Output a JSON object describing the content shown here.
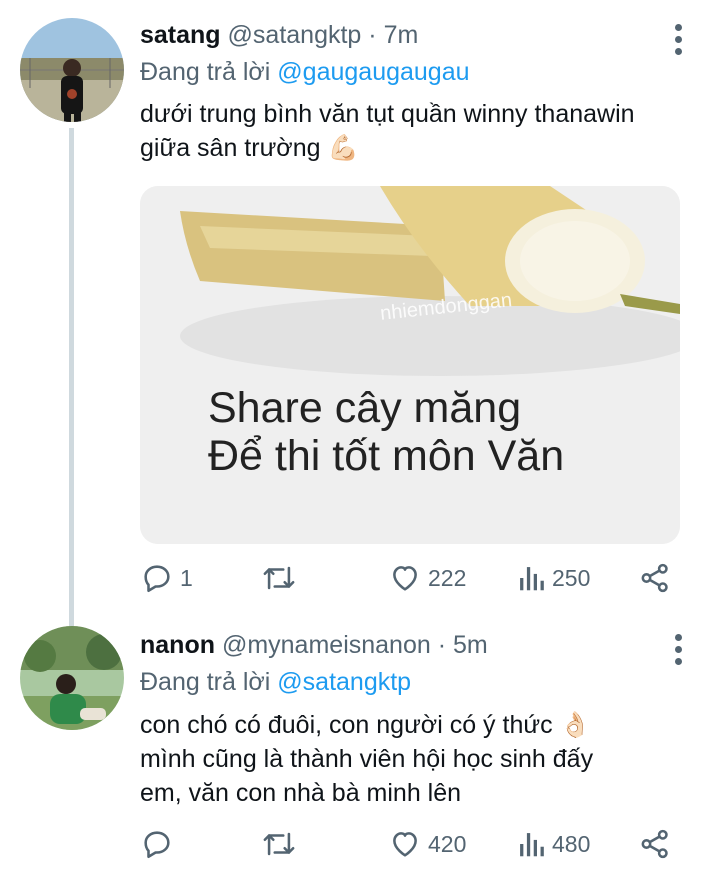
{
  "tweets": [
    {
      "name": "satang",
      "handle": "@satangktp",
      "time": "· 7m",
      "reply_prefix": "Đang trả lời",
      "reply_to": "@gaugaugaugau",
      "text_lines": [
        "dưới trung bình văn tụt quần winny thanawin",
        "giữa sân trường 💪🏻"
      ],
      "media": {
        "caption_lines": [
          "Share cây măng",
          "Để thi tốt môn Văn"
        ],
        "watermark": "nhiemdonggan"
      },
      "actions": {
        "reply_count": "1",
        "retweet_count": "",
        "like_count": "222",
        "view_count": "250"
      }
    },
    {
      "name": "nanon",
      "handle": "@mynameisnanon",
      "time": "· 5m",
      "reply_prefix": "Đang trả lời",
      "reply_to": "@satangktp",
      "text_lines": [
        "con chó có đuôi, con người có ý thức 👌🏻",
        "mình cũng là thành viên hội học sinh đấy",
        "em, văn con nhà bà minh lên"
      ],
      "actions": {
        "reply_count": "",
        "retweet_count": "",
        "like_count": "420",
        "view_count": "480"
      }
    }
  ],
  "colors": {
    "link": "#1d9bf0",
    "secondary": "#536471",
    "thread_line": "#cfd9de"
  },
  "icons": [
    "more-icon",
    "reply-icon",
    "retweet-icon",
    "like-icon",
    "views-icon",
    "share-icon"
  ]
}
